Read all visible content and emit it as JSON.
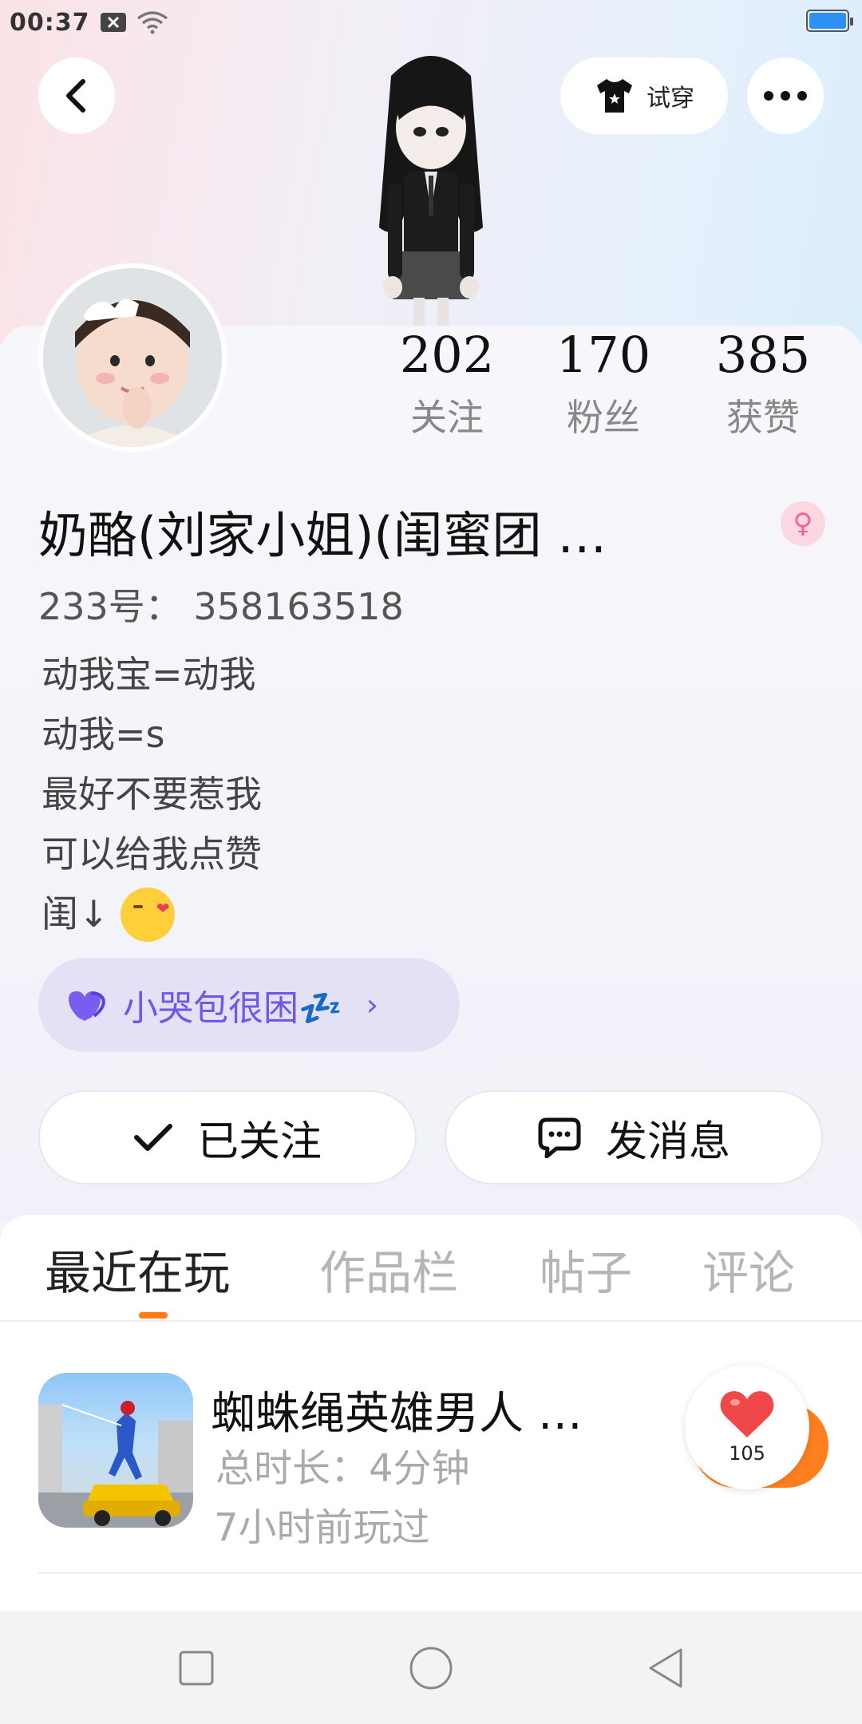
{
  "status_bar": {
    "time": "00:37"
  },
  "header": {
    "try_on_label": "试穿"
  },
  "stats": [
    {
      "value": "202",
      "label": "关注"
    },
    {
      "value": "170",
      "label": "粉丝"
    },
    {
      "value": "385",
      "label": "获赞"
    }
  ],
  "profile": {
    "name": "奶酪(刘家小姐)(闺蜜团 …",
    "id_text": "233号： 358163518",
    "bio": [
      "动我宝=动我",
      "动我=s",
      "最好不要惹我",
      "可以给我点赞",
      "闺↓"
    ],
    "club_label": "小哭包很困💤"
  },
  "actions": {
    "follow_label": "已关注",
    "message_label": "发消息"
  },
  "tabs": [
    {
      "label": "最近在玩",
      "active": true
    },
    {
      "label": "作品栏",
      "active": false
    },
    {
      "label": "帖子",
      "active": false
    },
    {
      "label": "评论",
      "active": false
    }
  ],
  "recent_game": {
    "title": "蜘蛛绳英雄男人 …",
    "duration": "总时长：4分钟",
    "last_played": "7小时前玩过",
    "likes": "105"
  },
  "colors": {
    "accent_orange": "#ff7f1e",
    "club_purple": "#6d59e8",
    "battery_blue": "#2f90f3"
  }
}
